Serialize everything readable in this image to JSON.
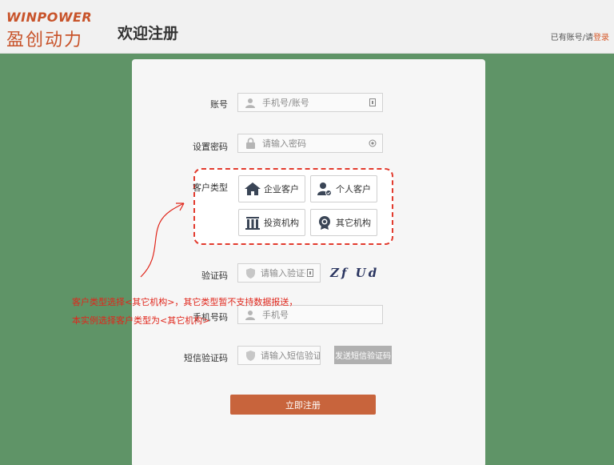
{
  "header": {
    "logo_en": "WINPOWER",
    "logo_cn": "盈创动力",
    "title": "欢迎注册",
    "login_prefix": "已有账号/请",
    "login_link": "登录"
  },
  "form": {
    "account_label": "账号",
    "account_placeholder": "手机号/账号",
    "password_label": "设置密码",
    "password_placeholder": "请输入密码",
    "customer_type_label": "客户类型",
    "customer_types": [
      {
        "label": "企业客户",
        "icon": "house-icon"
      },
      {
        "label": "个人客户",
        "icon": "person-icon"
      },
      {
        "label": "投资机构",
        "icon": "building-icon"
      },
      {
        "label": "其它机构",
        "icon": "badge-icon"
      }
    ],
    "captcha_label": "验证码",
    "captcha_placeholder": "请输入验证码",
    "captcha_image_text": "Zf Ud",
    "phone_label": "手机号码",
    "phone_placeholder": "手机号",
    "sms_label": "短信验证码",
    "sms_placeholder": "请输入短信验证码",
    "sms_button": "发送短信验证码",
    "submit_button": "立即注册"
  },
  "annotation": {
    "line1": "客户类型选择<其它机构>，其它类型暂不支持数据报送，",
    "line2": "本实例选择客户类型为<其它机构>"
  },
  "colors": {
    "background": "#5f9467",
    "accent": "#c8643c",
    "annotation": "#e0261b"
  }
}
